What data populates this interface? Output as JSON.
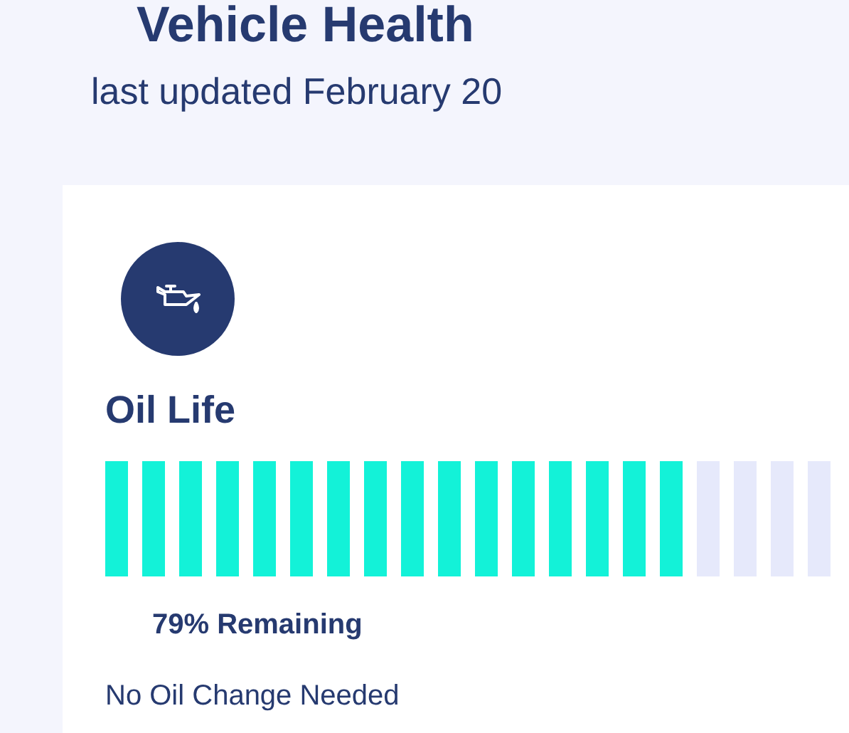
{
  "header": {
    "title": "Vehicle Health",
    "subtitle": "last updated February 20"
  },
  "card": {
    "title": "Oil Life",
    "meter": {
      "level": 0.79
    },
    "reading": "79% Remaining",
    "status": "No Oil Change Needed"
  }
}
